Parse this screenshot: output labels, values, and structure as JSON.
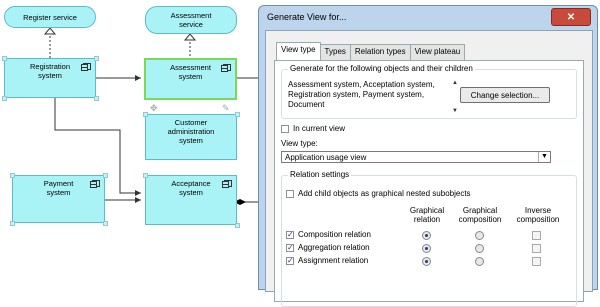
{
  "diagram": {
    "services": [
      {
        "id": "register-service",
        "label": "Register service"
      },
      {
        "id": "assessment-service",
        "label": "Assessment\nservice"
      }
    ],
    "components": [
      {
        "id": "registration-system",
        "label": "Registration\nsystem"
      },
      {
        "id": "assessment-system",
        "label": "Assessment\nsystem"
      },
      {
        "id": "customer-admin-system",
        "label": "Customer\nadministration\nsystem"
      },
      {
        "id": "payment-system",
        "label": "Payment\nsystem"
      },
      {
        "id": "acceptance-system",
        "label": "Acceptance\nsystem"
      }
    ],
    "colors": {
      "node_fill": "#a9f3f6",
      "node_border": "#5bbcc7",
      "selected_border": "#7ad85a"
    }
  },
  "dialog": {
    "title": "Generate View for...",
    "close_icon": "close-icon",
    "tabs": [
      {
        "label": "View type",
        "active": true
      },
      {
        "label": "Types",
        "active": false
      },
      {
        "label": "Relation types",
        "active": false
      },
      {
        "label": "View plateau",
        "active": false
      }
    ],
    "objects_group": {
      "label": "Generate for the following objects and their children",
      "list_text": "Assessment system, Acceptation system, Registration system, Payment system, Document",
      "change_button": "Change selection..."
    },
    "in_current_view": {
      "label": "In current view",
      "checked": false
    },
    "view_type": {
      "label": "View type:",
      "selected": "Application usage view"
    },
    "relation_settings": {
      "label": "Relation settings",
      "add_child": {
        "label": "Add child objects as graphical nested subobjects",
        "checked": false
      },
      "columns": [
        "Graphical\nrelation",
        "Graphical\ncomposition",
        "Inverse\ncomposition"
      ],
      "rows": [
        {
          "label": "Composition relation",
          "checked": true,
          "selected_column": 0
        },
        {
          "label": "Aggregation relation",
          "checked": true,
          "selected_column": 0
        },
        {
          "label": "Assignment relation",
          "checked": true,
          "selected_column": 0
        }
      ]
    }
  }
}
